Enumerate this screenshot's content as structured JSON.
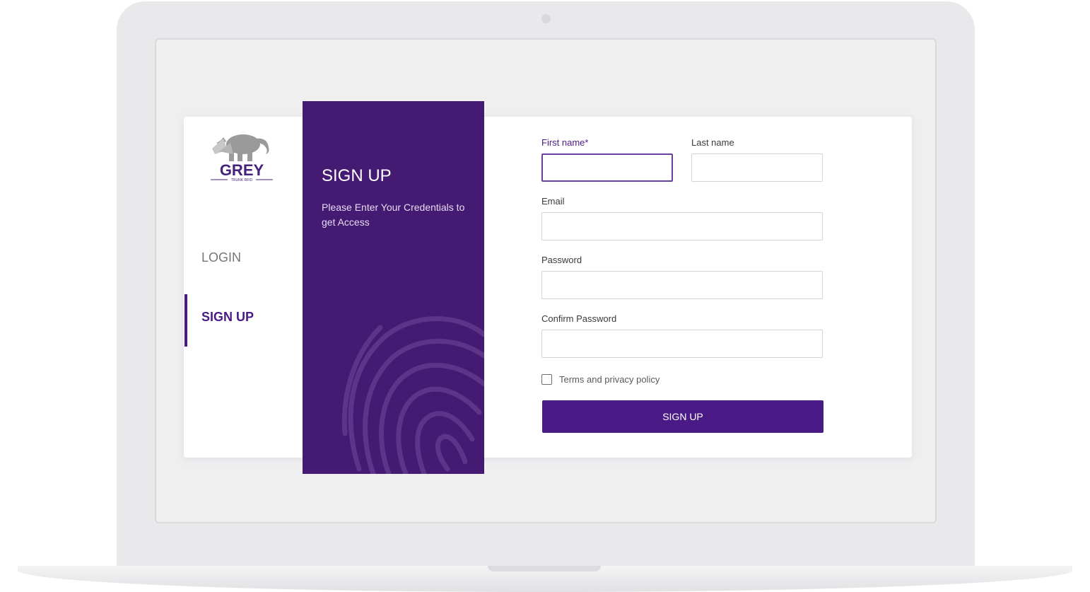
{
  "brand": {
    "logo_text": "GREY",
    "logo_subtext": "TRUNK RFID"
  },
  "nav": {
    "login_label": "LOGIN",
    "signup_label": "SIGN UP"
  },
  "panel": {
    "title": "SIGN UP",
    "subtitle": "Please Enter Your Credentials to get Access"
  },
  "form": {
    "first_name_label": "First name*",
    "last_name_label": "Last name",
    "email_label": "Email",
    "password_label": "Password",
    "confirm_password_label": "Confirm Password",
    "first_name_value": "",
    "last_name_value": "",
    "email_value": "",
    "password_value": "",
    "confirm_password_value": "",
    "terms_label": "Terms and privacy policy",
    "terms_checked": false,
    "submit_label": "SIGN UP"
  },
  "colors": {
    "primary": "#4a1a86",
    "panel": "#451a72",
    "background": "#efefef"
  }
}
